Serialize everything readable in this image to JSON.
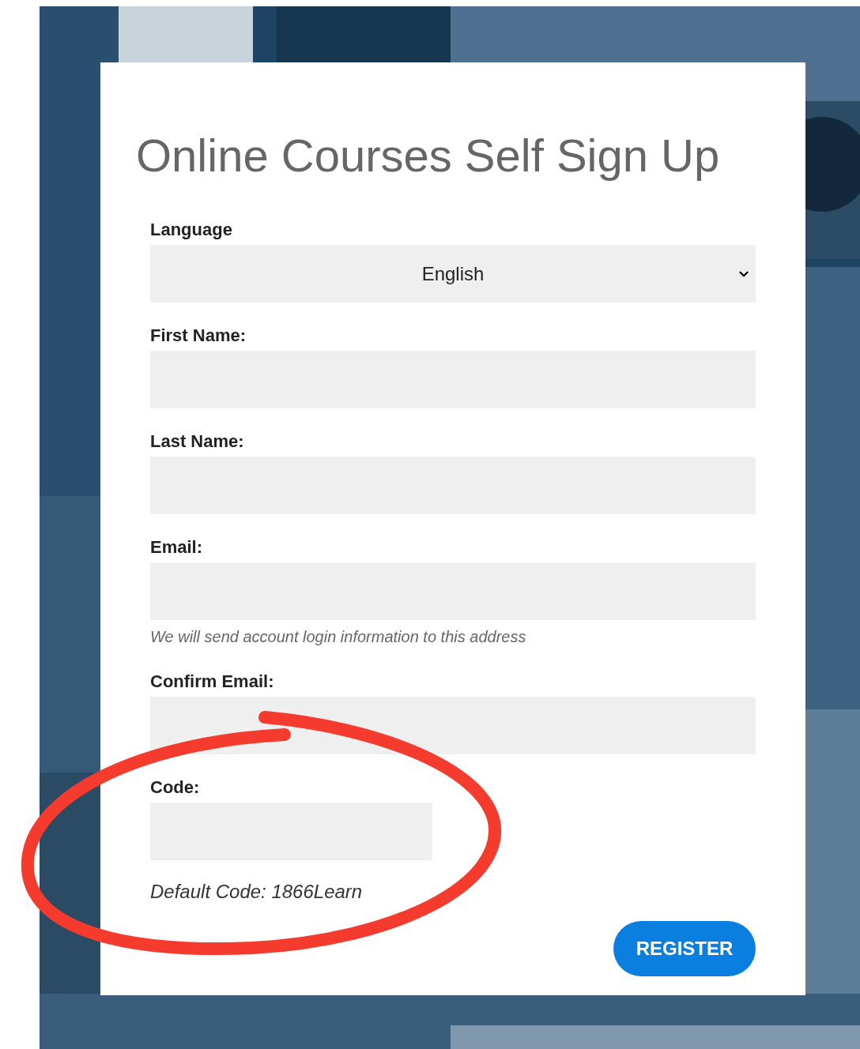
{
  "title": "Online Courses Self Sign Up",
  "fields": [
    {
      "kind": "select",
      "label": "Language",
      "value": "English"
    },
    {
      "kind": "text",
      "label": "First Name:"
    },
    {
      "kind": "text",
      "label": "Last Name:"
    },
    {
      "kind": "text",
      "label": "Email:",
      "hint": "We will send account login information to this address"
    },
    {
      "kind": "text",
      "label": "Confirm Email:"
    },
    {
      "kind": "short",
      "label": "Code:",
      "hint": "Default Code: 1866Learn"
    }
  ],
  "register_button": "REGISTER"
}
